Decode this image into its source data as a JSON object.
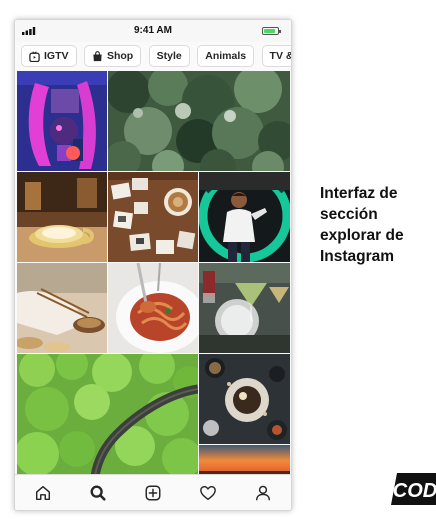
{
  "status_bar": {
    "time": "9:41 AM",
    "battery_level": 0.85
  },
  "chips": [
    {
      "label": "IGTV",
      "icon": "igtv-icon"
    },
    {
      "label": "Shop",
      "icon": "shop-bag-icon"
    },
    {
      "label": "Style"
    },
    {
      "label": "Animals"
    },
    {
      "label": "TV & M"
    }
  ],
  "grid_tiles": [
    {
      "name": "tile-neon-art",
      "icon": "photo-thumbnail"
    },
    {
      "name": "tile-tree-canopy",
      "icon": "photo-thumbnail"
    },
    {
      "name": "tile-cafe-latte",
      "icon": "photo-thumbnail"
    },
    {
      "name": "tile-photos-table",
      "icon": "photo-thumbnail"
    },
    {
      "name": "tile-man-portrait",
      "icon": "photo-thumbnail"
    },
    {
      "name": "tile-chopsticks-meal",
      "icon": "photo-thumbnail"
    },
    {
      "name": "tile-spaghetti",
      "icon": "photo-thumbnail"
    },
    {
      "name": "tile-cocktails",
      "icon": "photo-thumbnail"
    },
    {
      "name": "tile-forest-road",
      "icon": "photo-thumbnail"
    },
    {
      "name": "tile-dark-food",
      "icon": "photo-thumbnail"
    },
    {
      "name": "tile-sunset",
      "icon": "photo-thumbnail"
    }
  ],
  "bottom_nav": [
    {
      "name": "home",
      "icon": "home-icon"
    },
    {
      "name": "search",
      "icon": "search-icon",
      "active": true
    },
    {
      "name": "new-post",
      "icon": "plus-square-icon"
    },
    {
      "name": "activity",
      "icon": "heart-icon"
    },
    {
      "name": "profile",
      "icon": "profile-icon"
    }
  ],
  "caption": {
    "line1": "Interfaz de",
    "line2": "sección",
    "line3": "explorar de",
    "line4": "Instagram"
  },
  "logo": {
    "text": "COD"
  },
  "colors": {
    "text": "#262626",
    "border": "#dbdbdb",
    "battery": "#4cd964",
    "accent_teal": "#16c79a"
  }
}
